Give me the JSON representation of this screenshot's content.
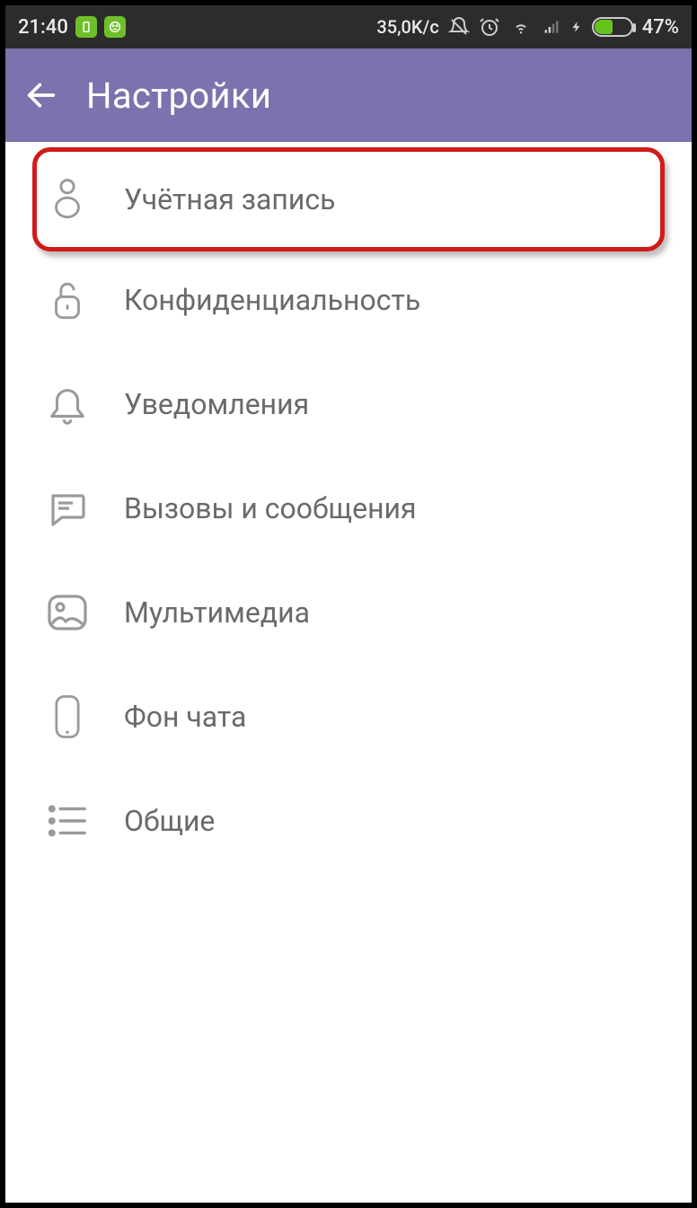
{
  "status": {
    "time": "21:40",
    "net_speed": "35,0K/c",
    "battery_pct": "47%"
  },
  "header": {
    "title": "Настройки"
  },
  "settings": {
    "items": [
      {
        "label": "Учётная запись",
        "icon": "person-icon",
        "highlighted": true
      },
      {
        "label": "Конфиденциальность",
        "icon": "lock-icon"
      },
      {
        "label": "Уведомления",
        "icon": "bell-icon"
      },
      {
        "label": "Вызовы и сообщения",
        "icon": "chat-icon"
      },
      {
        "label": "Мультимедиа",
        "icon": "media-icon"
      },
      {
        "label": "Фон чата",
        "icon": "phone-outline-icon"
      },
      {
        "label": "Общие",
        "icon": "list-icon"
      }
    ]
  }
}
